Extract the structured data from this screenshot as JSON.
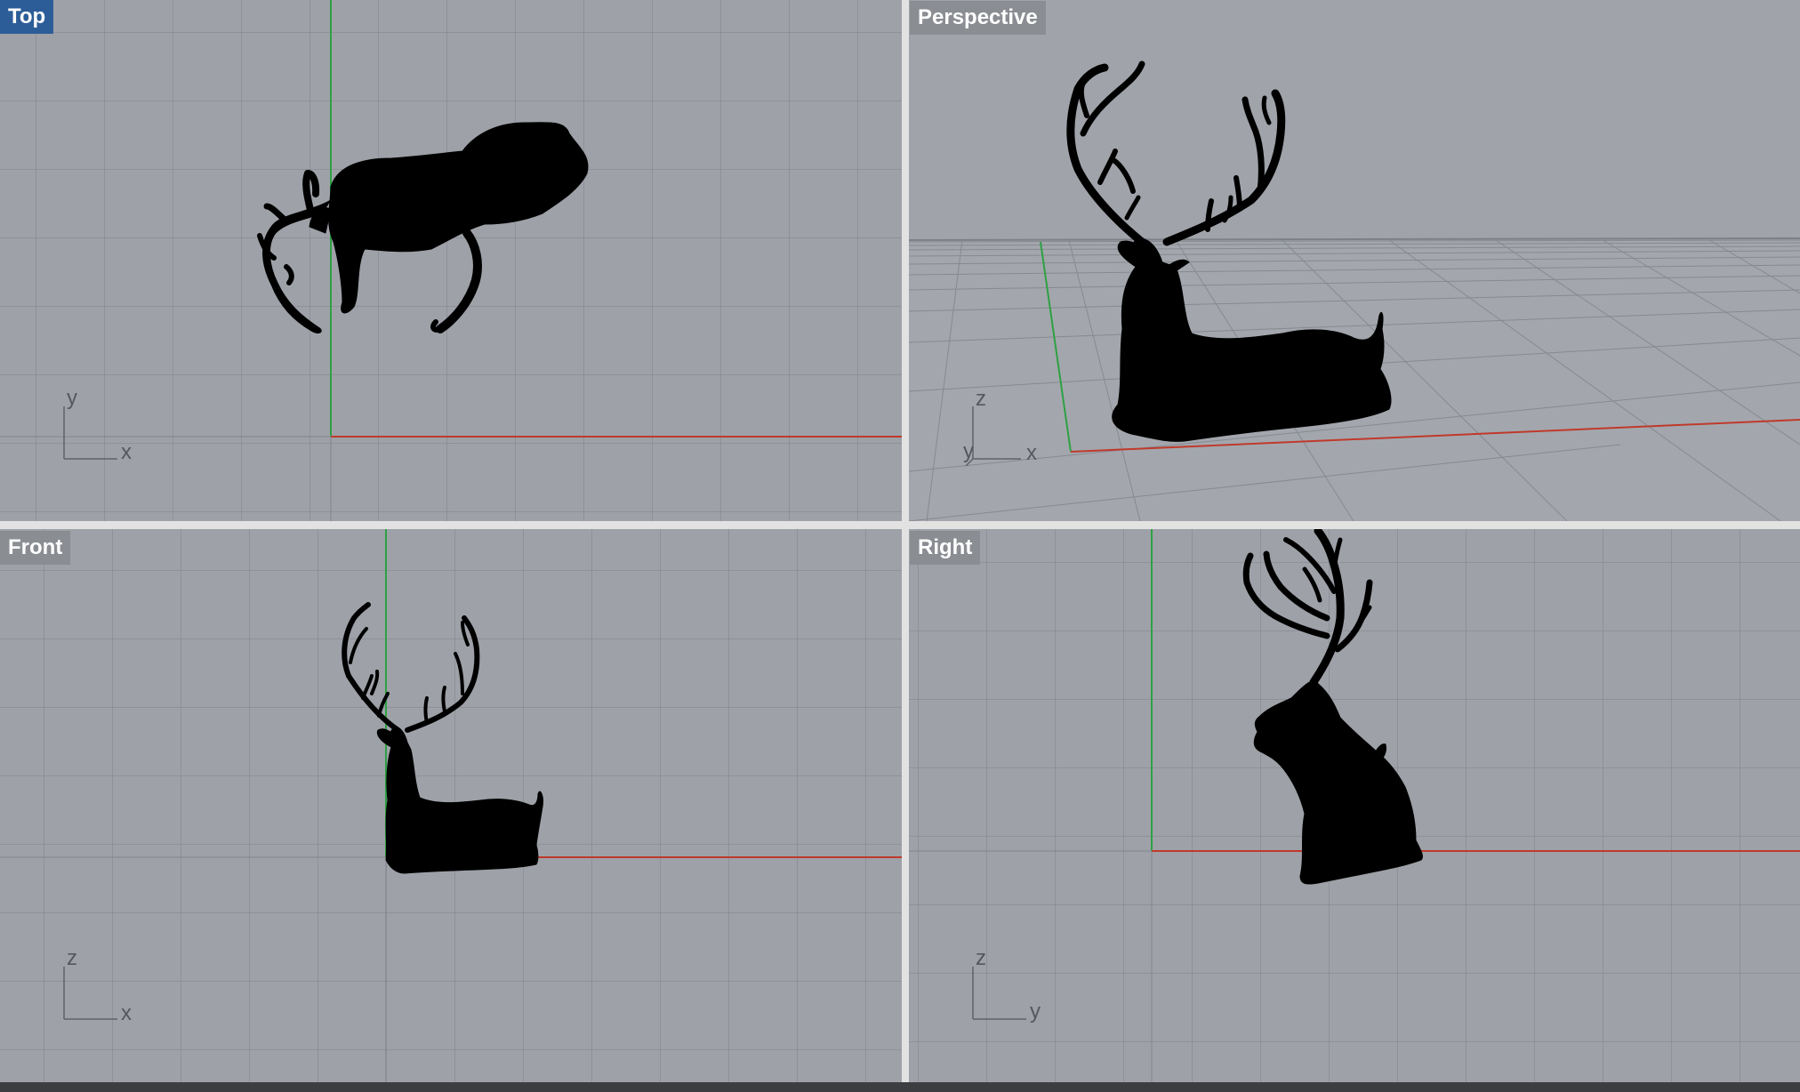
{
  "viewports": {
    "top": {
      "label": "Top",
      "axis_h": "x",
      "axis_v": "y"
    },
    "perspective": {
      "label": "Perspective",
      "axis_v": "z",
      "axis_d": "y",
      "axis_h": "x"
    },
    "front": {
      "label": "Front",
      "axis_h": "x",
      "axis_v": "z"
    },
    "right": {
      "label": "Right",
      "axis_h": "y",
      "axis_v": "z"
    }
  },
  "colors": {
    "viewport_bg": "#9ea2a8",
    "grid": "#7c8086",
    "x_axis": "#c0392b",
    "y_axis": "#2ea043",
    "model": "#000000",
    "active_label": "#2c5d98",
    "inactive_label": "#8a8d92"
  },
  "model": {
    "icon": "deer-silhouette-icon"
  }
}
